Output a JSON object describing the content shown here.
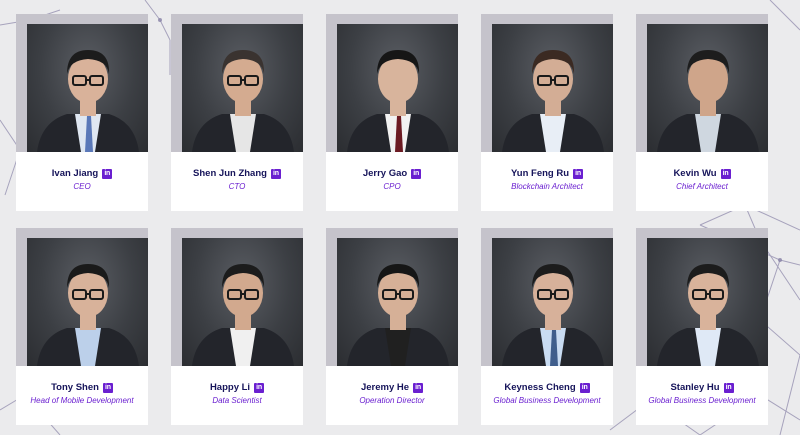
{
  "team": [
    {
      "name": "Ivan Jiang",
      "role": "CEO",
      "linkedin_icon": "linkedin-icon",
      "linkedin_text": "in"
    },
    {
      "name": "Shen Jun Zhang",
      "role": "CTO",
      "linkedin_icon": "linkedin-icon",
      "linkedin_text": "in"
    },
    {
      "name": "Jerry Gao",
      "role": "CPO",
      "linkedin_icon": "linkedin-icon",
      "linkedin_text": "in"
    },
    {
      "name": "Yun Feng Ru",
      "role": "Blockchain Architect",
      "linkedin_icon": "linkedin-icon",
      "linkedin_text": "in"
    },
    {
      "name": "Kevin Wu",
      "role": "Chief Architect",
      "linkedin_icon": "linkedin-icon",
      "linkedin_text": "in"
    },
    {
      "name": "Tony Shen",
      "role": "Head of Mobile Development",
      "linkedin_icon": "linkedin-icon",
      "linkedin_text": "in"
    },
    {
      "name": "Happy Li",
      "role": "Data Scientist",
      "linkedin_icon": "linkedin-icon",
      "linkedin_text": "in"
    },
    {
      "name": "Jeremy He",
      "role": "Operation Director",
      "linkedin_icon": "linkedin-icon",
      "linkedin_text": "in"
    },
    {
      "name": "Keyness Cheng",
      "role": "Global Business Development",
      "linkedin_icon": "linkedin-icon",
      "linkedin_text": "in"
    },
    {
      "name": "Stanley Hu",
      "role": "Global Business Development",
      "linkedin_icon": "linkedin-icon",
      "linkedin_text": "in"
    }
  ],
  "colors": {
    "background": "#ebebed",
    "card_shadow": "#c5c3cb",
    "name_text": "#16145a",
    "role_text": "#6a1fd0",
    "linkedin_badge": "#6a1fd0"
  }
}
